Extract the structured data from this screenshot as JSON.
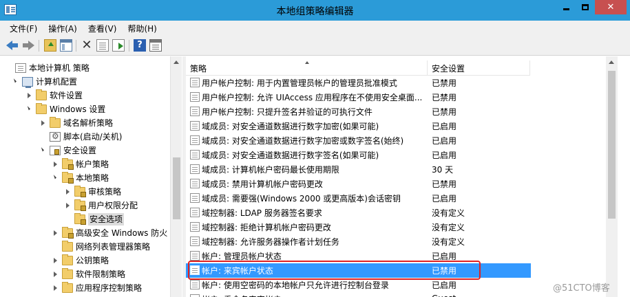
{
  "window": {
    "title": "本地组策略编辑器",
    "minimize_icon": "minimize-icon",
    "maximize_icon": "maximize-icon",
    "close_icon": "close-icon"
  },
  "menu": [
    "文件(F)",
    "操作(A)",
    "查看(V)",
    "帮助(H)"
  ],
  "toolbar": [
    "back-arrow-icon",
    "forward-arrow-icon",
    "up-folder-icon",
    "show-hide-tree-icon",
    "delete-icon",
    "properties-icon",
    "export-list-icon",
    "help-icon",
    "view-icon"
  ],
  "tree": [
    {
      "label": "本地计算机 策略",
      "icon": "document-icon",
      "level": 0,
      "toggle": "none"
    },
    {
      "label": "计算机配置",
      "icon": "computer-icon",
      "level": 1,
      "toggle": "expanded"
    },
    {
      "label": "软件设置",
      "icon": "folder-icon",
      "level": 2,
      "toggle": "collapsed"
    },
    {
      "label": "Windows 设置",
      "icon": "folder-icon",
      "level": 2,
      "toggle": "expanded"
    },
    {
      "label": "域名解析策略",
      "icon": "folder-icon",
      "level": 3,
      "toggle": "collapsed"
    },
    {
      "label": "脚本(启动/关机)",
      "icon": "script-icon",
      "level": 3,
      "toggle": "none"
    },
    {
      "label": "安全设置",
      "icon": "security-icon",
      "level": 3,
      "toggle": "expanded"
    },
    {
      "label": "帐户策略",
      "icon": "locked-folder-icon",
      "level": 4,
      "toggle": "collapsed"
    },
    {
      "label": "本地策略",
      "icon": "locked-folder-icon",
      "level": 4,
      "toggle": "expanded"
    },
    {
      "label": "审核策略",
      "icon": "locked-folder-icon",
      "level": 5,
      "toggle": "collapsed"
    },
    {
      "label": "用户权限分配",
      "icon": "locked-folder-icon",
      "level": 5,
      "toggle": "collapsed"
    },
    {
      "label": "安全选项",
      "icon": "locked-folder-icon",
      "level": 5,
      "toggle": "none",
      "selected": true
    },
    {
      "label": "高级安全 Windows 防火",
      "icon": "locked-folder-icon",
      "level": 4,
      "toggle": "collapsed"
    },
    {
      "label": "网络列表管理器策略",
      "icon": "folder-icon",
      "level": 4,
      "toggle": "none"
    },
    {
      "label": "公钥策略",
      "icon": "folder-icon",
      "level": 4,
      "toggle": "collapsed"
    },
    {
      "label": "软件限制策略",
      "icon": "folder-icon",
      "level": 4,
      "toggle": "collapsed"
    },
    {
      "label": "应用程序控制策略",
      "icon": "folder-icon",
      "level": 4,
      "toggle": "collapsed"
    }
  ],
  "list": {
    "columns": [
      "策略",
      "安全设置"
    ],
    "rows": [
      {
        "policy": "用户帐户控制: 用于内置管理员帐户的管理员批准模式",
        "setting": "已禁用"
      },
      {
        "policy": "用户帐户控制: 允许 UIAccess 应用程序在不使用安全桌面...",
        "setting": "已禁用"
      },
      {
        "policy": "用户帐户控制: 只提升签名并验证的可执行文件",
        "setting": "已禁用"
      },
      {
        "policy": "域成员: 对安全通道数据进行数字加密(如果可能)",
        "setting": "已启用"
      },
      {
        "policy": "域成员: 对安全通道数据进行数字加密或数字签名(始终)",
        "setting": "已启用"
      },
      {
        "policy": "域成员: 对安全通道数据进行数字签名(如果可能)",
        "setting": "已启用"
      },
      {
        "policy": "域成员: 计算机帐户密码最长使用期限",
        "setting": "30 天"
      },
      {
        "policy": "域成员: 禁用计算机帐户密码更改",
        "setting": "已禁用"
      },
      {
        "policy": "域成员: 需要强(Windows 2000 或更高版本)会话密钥",
        "setting": "已启用"
      },
      {
        "policy": "域控制器: LDAP 服务器签名要求",
        "setting": "没有定义"
      },
      {
        "policy": "域控制器: 拒绝计算机帐户密码更改",
        "setting": "没有定义"
      },
      {
        "policy": "域控制器: 允许服务器操作者计划任务",
        "setting": "没有定义"
      },
      {
        "policy": "帐户: 管理员帐户状态",
        "setting": "已启用"
      },
      {
        "policy": "帐户: 来宾帐户状态",
        "setting": "已禁用",
        "selected": true
      },
      {
        "policy": "帐户: 使用空密码的本地帐户只允许进行控制台登录",
        "setting": "已启用"
      },
      {
        "policy": "帐户: 重命名来宾帐户",
        "setting": "Guest"
      }
    ]
  },
  "watermark": "@51CTO博客"
}
